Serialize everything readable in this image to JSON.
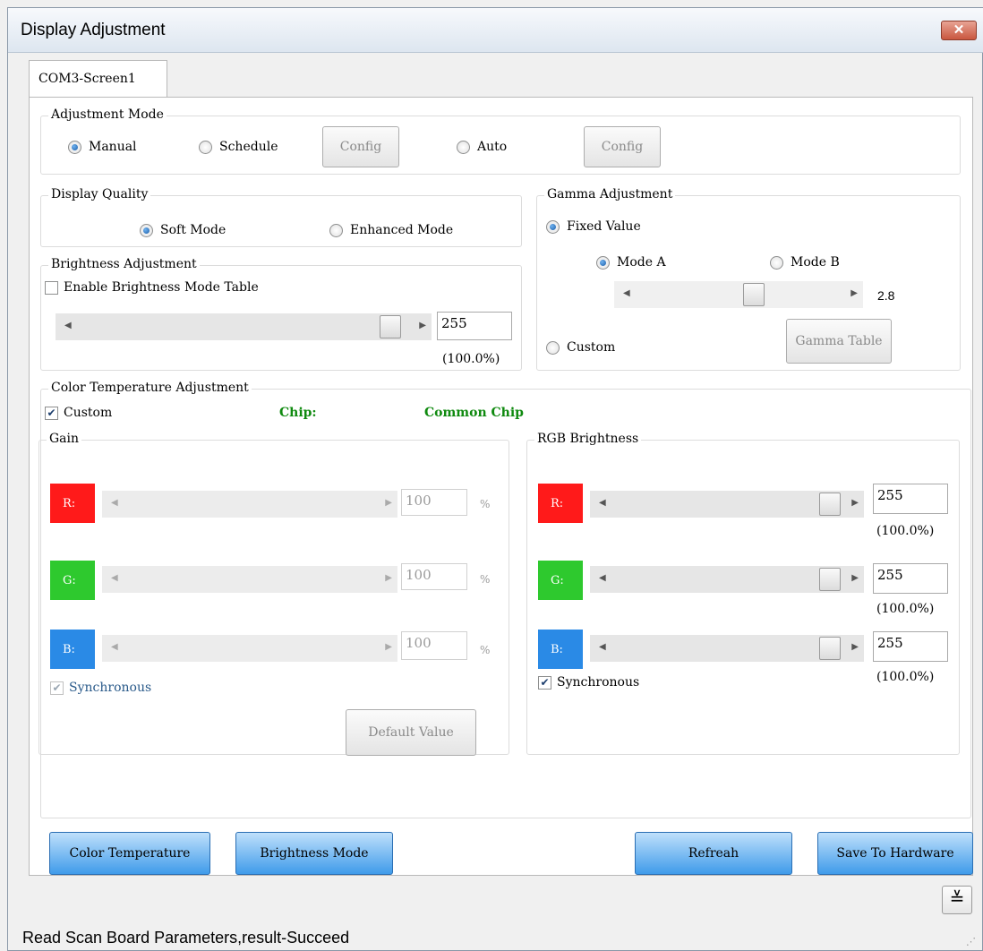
{
  "window": {
    "title": "Display Adjustment",
    "close": "✕"
  },
  "tab": {
    "label": "COM3-Screen1"
  },
  "adjustment_mode": {
    "legend": "Adjustment Mode",
    "manual": "Manual",
    "schedule": "Schedule",
    "config1": "Config",
    "auto": "Auto",
    "config2": "Config",
    "selected": "Manual"
  },
  "display_quality": {
    "legend": "Display Quality",
    "soft": "Soft Mode",
    "enhanced": "Enhanced Mode",
    "selected": "Soft Mode"
  },
  "brightness": {
    "legend": "Brightness Adjustment",
    "enable": "Enable Brightness Mode Table",
    "value": "255",
    "percent": "(100.0%)",
    "level": 1.0
  },
  "gamma": {
    "legend": "Gamma Adjustment",
    "fixed": "Fixed Value",
    "mode_a": "Mode A",
    "mode_b": "Mode B",
    "value": "2.8",
    "custom": "Custom",
    "table_button": "Gamma Table"
  },
  "color_temp": {
    "legend": "Color Temperature Adjustment",
    "custom": "Custom",
    "chip_label": "Chip:",
    "chip_value": "Common Chip",
    "gain": {
      "legend": "Gain",
      "rows": [
        {
          "label": "R:",
          "value": "100",
          "unit": "%",
          "color": "#ff1a1a"
        },
        {
          "label": "G:",
          "value": "100",
          "unit": "%",
          "color": "#2ec92e"
        },
        {
          "label": "B:",
          "value": "100",
          "unit": "%",
          "color": "#2a8ae6"
        }
      ],
      "sync": "Synchronous",
      "default_button": "Default Value"
    },
    "rgb": {
      "legend": "RGB Brightness",
      "rows": [
        {
          "label": "R:",
          "value": "255",
          "percent": "(100.0%)",
          "color": "#ff1a1a"
        },
        {
          "label": "G:",
          "value": "255",
          "percent": "(100.0%)",
          "color": "#2ec92e"
        },
        {
          "label": "B:",
          "value": "255",
          "percent": "(100.0%)",
          "color": "#2a8ae6"
        }
      ],
      "sync": "Synchronous"
    }
  },
  "buttons": {
    "color_temperature": "Color Temperature",
    "brightness_mode": "Brightness Mode",
    "refresh": "Refreah",
    "save": "Save To Hardware"
  },
  "status": {
    "text": "Read Scan Board Parameters,result-Succeed"
  },
  "expand_icon": "≚"
}
